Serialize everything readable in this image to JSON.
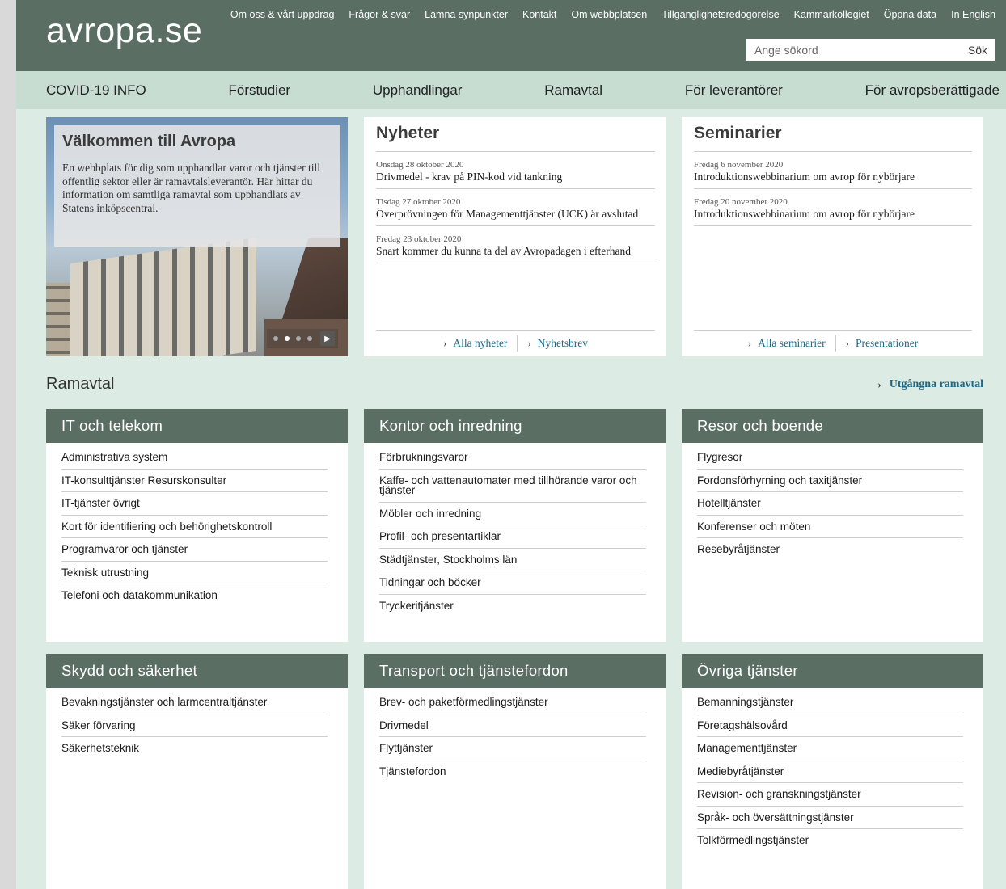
{
  "header": {
    "logo": "avropa.se",
    "toplinks": [
      "Om oss & vårt uppdrag",
      "Frågor & svar",
      "Lämna synpunkter",
      "Kontakt",
      "Om webbplatsen",
      "Tillgänglighetsredogörelse",
      "Kammarkollegiet",
      "Öppna data",
      "In English"
    ],
    "search_placeholder": "Ange sökord",
    "search_button": "Sök"
  },
  "nav": [
    "COVID-19 INFO",
    "Förstudier",
    "Upphandlingar",
    "Ramavtal",
    "För leverantörer",
    "För avropsberättigade"
  ],
  "hero": {
    "title": "Välkommen till Avropa",
    "text": "En webbplats för dig som upphandlar varor och tjänster till offentlig sektor eller är ramavtalsleverantör. Här hittar du information om samtliga ramavtal som upphandlats av Statens inköpscentral."
  },
  "news": {
    "title": "Nyheter",
    "items": [
      {
        "date": "Onsdag 28 oktober 2020",
        "title": "Drivmedel - krav på PIN-kod vid tankning"
      },
      {
        "date": "Tisdag 27 oktober 2020",
        "title": "Överprövningen för Managementtjänster (UCK) är avslutad"
      },
      {
        "date": "Fredag 23 oktober 2020",
        "title": "Snart kommer du kunna ta del av Avropadagen i efterhand"
      }
    ],
    "links": [
      "Alla nyheter",
      "Nyhetsbrev"
    ]
  },
  "seminars": {
    "title": "Seminarier",
    "items": [
      {
        "date": "Fredag 6 november 2020",
        "title": "Introduktionswebbinarium om avrop för nybörjare"
      },
      {
        "date": "Fredag 20 november 2020",
        "title": "Introduktionswebbinarium om avrop för nybörjare"
      }
    ],
    "links": [
      "Alla seminarier",
      "Presentationer"
    ]
  },
  "ramavtal": {
    "title": "Ramavtal",
    "expired_link": "Utgångna ramavtal",
    "categories": [
      {
        "title": "IT och telekom",
        "items": [
          "Administrativa system",
          "IT-konsulttjänster Resurskonsulter",
          "IT-tjänster övrigt",
          "Kort för identifiering och behörighetskontroll",
          "Programvaror och tjänster",
          "Teknisk utrustning",
          "Telefoni och datakommunikation"
        ]
      },
      {
        "title": "Kontor och inredning",
        "items": [
          "Förbrukningsvaror",
          "Kaffe- och vattenautomater med tillhörande varor och tjänster",
          "Möbler och inredning",
          "Profil- och presentartiklar",
          "Städtjänster, Stockholms län",
          "Tidningar och böcker",
          "Tryckeritjänster"
        ]
      },
      {
        "title": "Resor och boende",
        "items": [
          "Flygresor",
          "Fordonsförhyrning och taxitjänster",
          "Hotelltjänster",
          "Konferenser och möten",
          "Resebyråtjänster"
        ]
      },
      {
        "title": "Skydd och säkerhet",
        "items": [
          "Bevakningstjänster och larmcentraltjänster",
          "Säker förvaring",
          "Säkerhetsteknik"
        ]
      },
      {
        "title": "Transport och tjänstefordon",
        "items": [
          "Brev- och paketförmedlingstjänster",
          "Drivmedel",
          "Flyttjänster",
          "Tjänstefordon"
        ]
      },
      {
        "title": "Övriga tjänster",
        "items": [
          "Bemanningstjänster",
          "Företagshälsovård",
          "Managementtjänster",
          "Mediebyråtjänster",
          "Revision- och granskningstjänster",
          "Språk- och översättningstjänster",
          "Tolkförmedlingstjänster"
        ]
      }
    ]
  }
}
